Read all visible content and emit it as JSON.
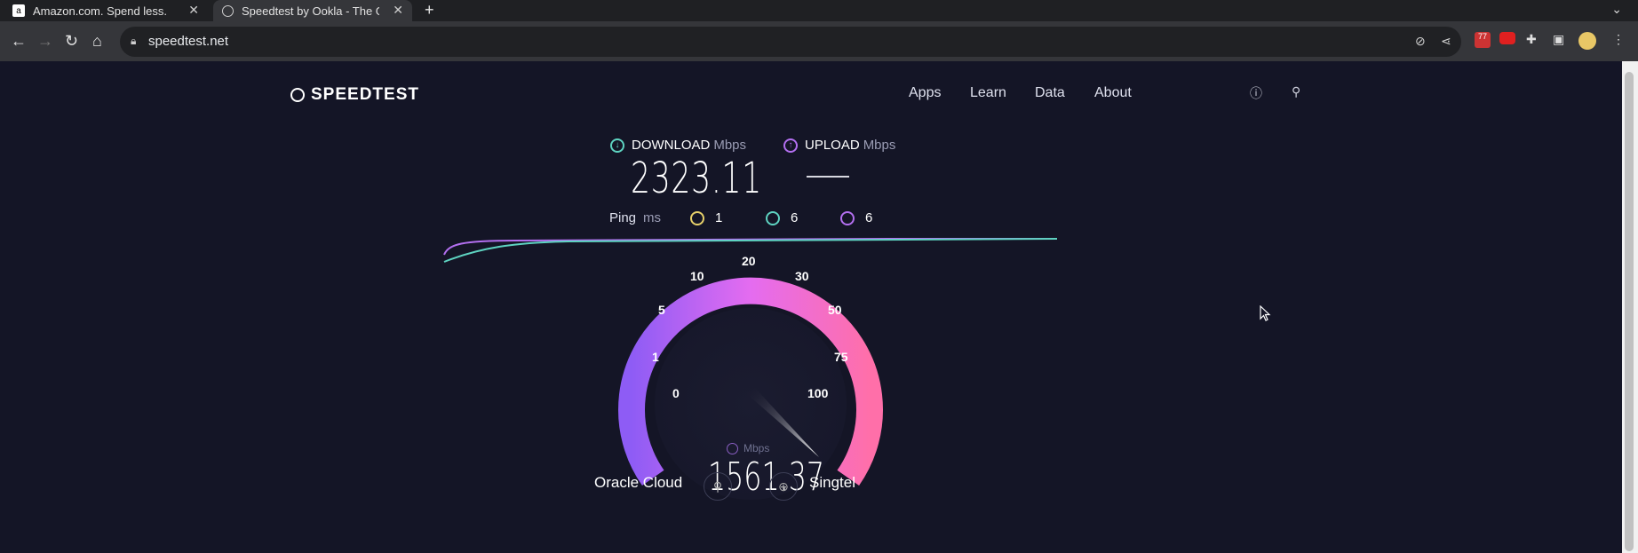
{
  "browser": {
    "tabs": [
      {
        "title": "Amazon.com. Spend less.",
        "icon": "amazon-favicon"
      },
      {
        "title": "Speedtest by Ookla - The Global Broadband Speed Test",
        "icon": "speedtest-favicon"
      }
    ],
    "url": "speedtest.net",
    "extension_badge": "77"
  },
  "site": {
    "logo_text": "SPEEDTEST",
    "nav": [
      "Apps",
      "Learn",
      "Data",
      "About"
    ]
  },
  "result": {
    "download_label": "DOWNLOAD",
    "upload_label": "UPLOAD",
    "unit": "Mbps",
    "download_value": "2323.11",
    "ping_label": "Ping",
    "ping_unit": "ms",
    "ping_idle": "1",
    "ping_download": "6",
    "ping_upload": "6",
    "current_speed": "1561.37",
    "current_unit": "Mbps"
  },
  "gauge": {
    "ticks": [
      "0",
      "1",
      "5",
      "10",
      "20",
      "30",
      "50",
      "75",
      "100"
    ],
    "needle_value": 100
  },
  "servers": {
    "isp": "Oracle Cloud",
    "host": "Singtel"
  },
  "colors": {
    "download": "#5ed3c1",
    "upload": "#b36ff0",
    "ping_idle": "#e6d06a",
    "gauge_start": "#8e5cf5",
    "gauge_end": "#ff6fa9",
    "background": "#141526"
  }
}
